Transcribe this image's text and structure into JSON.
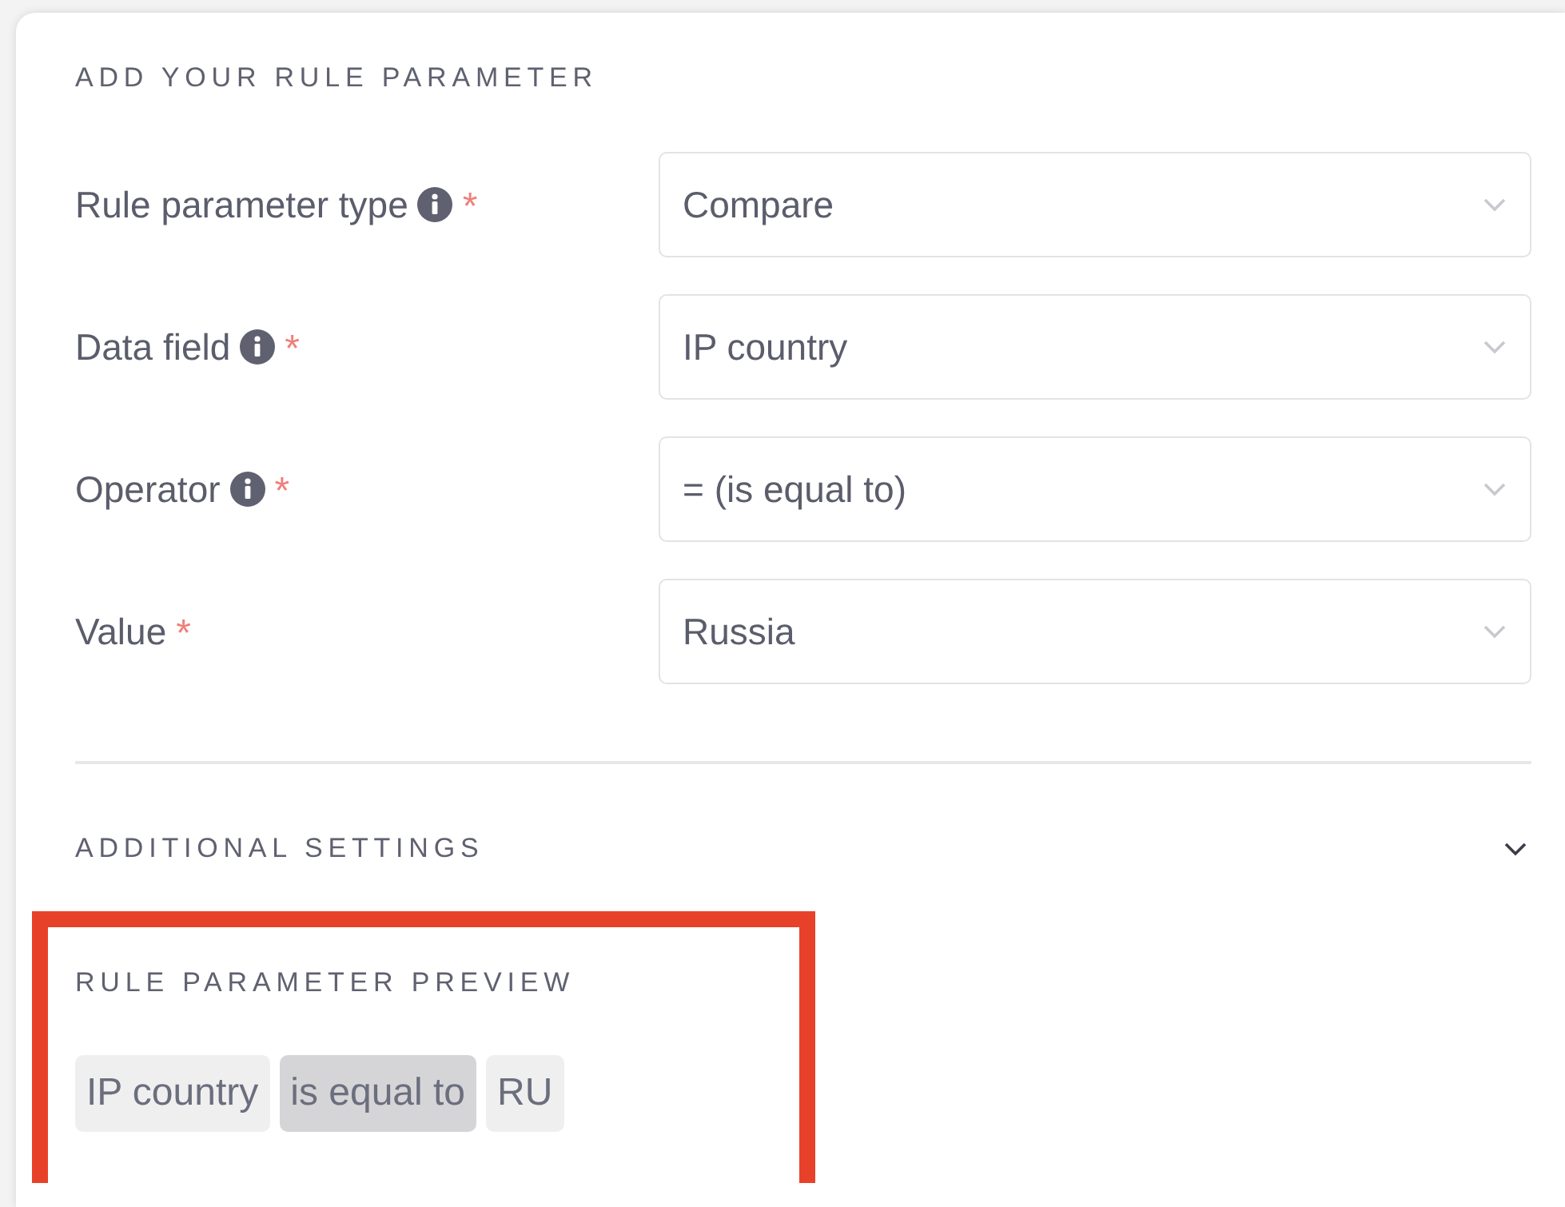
{
  "section_title": "ADD YOUR RULE PARAMETER",
  "fields": [
    {
      "label": "Rule parameter type",
      "info": true,
      "required_mark": "*",
      "value": "Compare"
    },
    {
      "label": "Data field",
      "info": true,
      "required_mark": "*",
      "value": "IP country"
    },
    {
      "label": "Operator",
      "info": true,
      "required_mark": "*",
      "value": "= (is equal to)"
    },
    {
      "label": "Value",
      "info": false,
      "required_mark": "*",
      "value": "Russia"
    }
  ],
  "additional_settings": {
    "title": "ADDITIONAL SETTINGS",
    "expanded": false
  },
  "preview": {
    "title": "RULE PARAMETER PREVIEW",
    "highlighted": true,
    "chips": [
      {
        "text": "IP country",
        "kind": "field"
      },
      {
        "text": "is equal to",
        "kind": "operator"
      },
      {
        "text": "RU",
        "kind": "value"
      }
    ]
  }
}
